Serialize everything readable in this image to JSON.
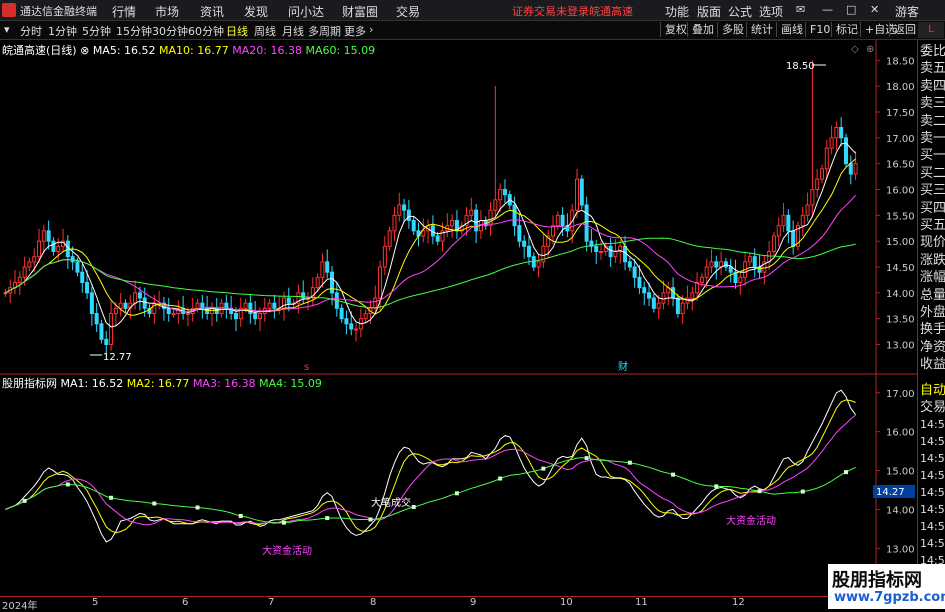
{
  "app": {
    "title": "通达信金融终端"
  },
  "menu": [
    "行情",
    "市场",
    "资讯",
    "发现",
    "问小达",
    "财富圈",
    "交易"
  ],
  "notice": {
    "not_logged": "证券交易未登录",
    "stock": "皖通高速"
  },
  "menu_right": [
    "功能",
    "版面",
    "公式",
    "选项"
  ],
  "guest": "游客",
  "periods": [
    "分时",
    "1分钟",
    "5分钟",
    "15分钟",
    "30分钟",
    "60分钟",
    "日线",
    "周线",
    "月线",
    "多周期",
    "更多"
  ],
  "period_selected": "日线",
  "toolbar_right": [
    "复权",
    "叠加",
    "多股",
    "统计",
    "画线",
    "F10",
    "标记",
    "+自选",
    "返回"
  ],
  "main_chart": {
    "stock_label": "皖通高速(日线)",
    "ma_labels": [
      "MA5: 16.52",
      "MA10: 16.77",
      "MA20: 16.38",
      "MA60: 15.09"
    ],
    "markers": {
      "high": "18.50",
      "low": "12.77",
      "s": "s",
      "cai": "财"
    }
  },
  "sub_chart": {
    "indicator_label": "股朋指标网",
    "ma_labels": [
      "MA1: 16.52",
      "MA2: 16.77",
      "MA3: 16.38",
      "MA4: 15.09"
    ],
    "annotations": [
      "大笔成交",
      "大资金活动",
      "大资金活动"
    ],
    "current": "14.27"
  },
  "side_panel": {
    "items": [
      "委比",
      "卖五",
      "卖四",
      "卖三",
      "卖二",
      "卖一",
      "买一",
      "买二",
      "买三",
      "买四",
      "买五",
      "现价",
      "涨跌",
      "涨幅",
      "总量",
      "外盘",
      "换手",
      "净资",
      "收益"
    ],
    "lower": [
      "自动",
      "交易",
      "14:56",
      "14:56",
      "14:56",
      "14:56",
      "14:56",
      "14:56",
      "14:56",
      "14:56",
      "14:56",
      "14:56"
    ]
  },
  "watermark": {
    "text": "股朋指标网",
    "url": "www.7gpzb.com"
  },
  "colors": {
    "up": "#ff3030",
    "down": "#30d8ff",
    "ma5": "#ffffff",
    "ma10": "#ffff00",
    "ma20": "#ff44ff",
    "ma60": "#44ff44"
  },
  "chart_data": [
    {
      "type": "candlestick",
      "yticks": [
        "18.50",
        "18.00",
        "17.50",
        "17.00",
        "16.50",
        "16.00",
        "15.50",
        "15.00",
        "14.50",
        "14.00",
        "13.50",
        "13.00"
      ],
      "ylim": [
        12.7,
        18.7
      ],
      "xticks": [
        "2024年",
        "5",
        "6",
        "7",
        "8",
        "9",
        "10",
        "11",
        "12"
      ],
      "close": [
        14.0,
        14.1,
        14.2,
        14.3,
        14.5,
        14.6,
        14.7,
        15.0,
        15.2,
        15.0,
        14.8,
        14.9,
        15.0,
        14.7,
        14.6,
        14.4,
        14.2,
        14.0,
        13.6,
        13.4,
        13.1,
        13.0,
        13.6,
        13.7,
        13.8,
        13.7,
        13.8,
        14.0,
        13.9,
        13.7,
        13.6,
        13.8,
        13.8,
        13.7,
        13.6,
        13.6,
        13.7,
        13.6,
        13.6,
        13.7,
        13.8,
        13.7,
        13.6,
        13.7,
        13.6,
        13.8,
        13.7,
        13.6,
        13.5,
        13.7,
        13.8,
        13.6,
        13.5,
        13.6,
        13.7,
        13.8,
        13.7,
        13.7,
        13.9,
        13.8,
        13.8,
        14.0,
        13.9,
        13.9,
        14.1,
        14.3,
        14.6,
        14.4,
        14.0,
        13.7,
        13.5,
        13.4,
        13.3,
        13.3,
        13.5,
        13.6,
        13.7,
        13.9,
        14.5,
        14.9,
        15.2,
        15.5,
        15.7,
        15.6,
        15.4,
        15.2,
        15.1,
        15.2,
        15.3,
        15.1,
        15.0,
        15.2,
        15.3,
        15.4,
        15.2,
        15.3,
        15.5,
        15.6,
        15.2,
        15.4,
        15.3,
        15.6,
        15.8,
        16.0,
        15.9,
        15.7,
        15.3,
        15.0,
        14.9,
        14.7,
        14.5,
        14.6,
        14.9,
        15.1,
        15.3,
        15.5,
        15.3,
        15.2,
        15.6,
        16.2,
        15.7,
        15.0,
        14.9,
        14.8,
        14.8,
        14.9,
        14.7,
        14.8,
        14.9,
        14.6,
        14.5,
        14.3,
        14.1,
        14.0,
        13.9,
        13.7,
        13.8,
        14.0,
        14.1,
        13.9,
        13.6,
        13.8,
        13.9,
        14.0,
        14.2,
        14.3,
        14.5,
        14.6,
        14.5,
        14.6,
        14.5,
        14.4,
        14.2,
        14.3,
        14.6,
        14.7,
        14.5,
        14.4,
        14.6,
        14.8,
        15.1,
        15.3,
        15.5,
        15.2,
        14.9,
        15.3,
        15.5,
        15.7,
        16.0,
        16.2,
        16.4,
        16.8,
        17.0,
        17.2,
        17.0,
        16.5,
        16.3,
        16.5
      ],
      "high_label": "18.50",
      "low_label": "12.77"
    },
    {
      "type": "line",
      "yticks": [
        "17.00",
        "16.00",
        "15.00",
        "14.00",
        "13.00"
      ],
      "ylim": [
        12.7,
        17.2
      ],
      "current_value": "14.27"
    }
  ]
}
